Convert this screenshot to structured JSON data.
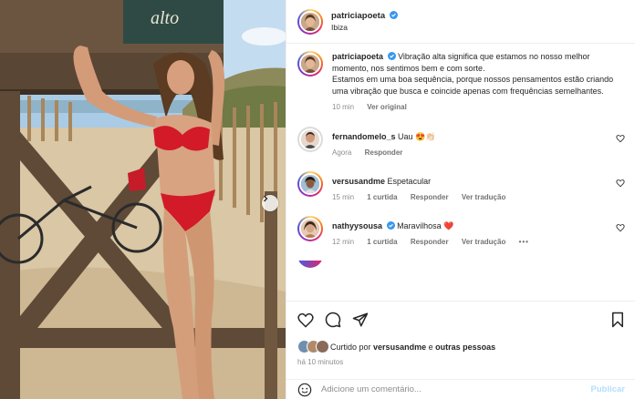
{
  "post": {
    "author": "patriciapoeta",
    "location": "Ibiza",
    "sign_text": "alto"
  },
  "caption": {
    "username": "patriciapoeta",
    "line1": "Vibração alta significa que estamos no nosso melhor momento, nos sentimos bem e com sorte.",
    "line2": "Estamos em uma boa sequência, porque nossos pensamentos estão criando uma vibração que busca e coincide apenas com frequências semelhantes.",
    "time": "10 min",
    "see_original": "Ver original"
  },
  "comments": [
    {
      "username": "fernandomelo_s",
      "text": "Uau",
      "emoji": "😍👏🏻",
      "time": "Agora",
      "reply": "Responder",
      "verified": false
    },
    {
      "username": "versusandme",
      "text": "Espetacular",
      "time": "15 min",
      "likes": "1 curtida",
      "reply": "Responder",
      "translate": "Ver tradução",
      "verified": false
    },
    {
      "username": "nathyysousa",
      "text": "Maravilhosa",
      "emoji": "❤️",
      "time": "12 min",
      "likes": "1 curtida",
      "reply": "Responder",
      "translate": "Ver tradução",
      "more": "•••",
      "verified": true
    }
  ],
  "likes": {
    "prefix": "Curtido por",
    "user": "versusandme",
    "connector": "e",
    "rest": "outras pessoas",
    "time_ago": "há 10 minutos"
  },
  "composer": {
    "placeholder": "Adicione um comentário...",
    "publish": "Publicar"
  },
  "icons": {
    "like": "heart-icon",
    "comment": "comment-icon",
    "share": "send-icon",
    "save": "bookmark-icon",
    "emoji": "smiley-icon",
    "next": "chevron-right-icon"
  },
  "colors": {
    "verified": "#3897f0",
    "link_blue": "#b2dffc",
    "muted": "#8e8e8e"
  }
}
